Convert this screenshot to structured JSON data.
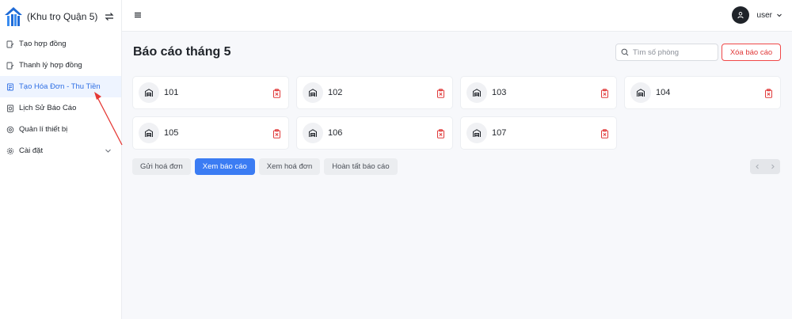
{
  "brand": {
    "name": "(Khu trọ Quận 5)"
  },
  "sidebar": {
    "items": [
      {
        "label": "Tạo hợp đồng"
      },
      {
        "label": "Thanh lý hợp đồng"
      },
      {
        "label": "Tạo Hóa Đơn - Thu Tiền"
      },
      {
        "label": "Lịch Sử Báo Cáo"
      },
      {
        "label": "Quản lí thiết bị"
      },
      {
        "label": "Cài đặt"
      }
    ]
  },
  "header": {
    "user_name": "user"
  },
  "main": {
    "title": "Báo cáo tháng 5",
    "search_placeholder": "Tìm số phòng",
    "delete_report_label": "Xóa báo cáo",
    "rooms": [
      {
        "number": "101"
      },
      {
        "number": "102"
      },
      {
        "number": "103"
      },
      {
        "number": "104"
      },
      {
        "number": "105"
      },
      {
        "number": "106"
      },
      {
        "number": "107"
      }
    ],
    "actions": {
      "send_invoice": "Gửi hoá đơn",
      "view_report": "Xem báo cáo",
      "view_invoice": "Xem hoá đơn",
      "complete_report": "Hoàn tất báo cáo"
    }
  },
  "colors": {
    "accent": "#3b7cf3",
    "active_nav_text": "#2f6fe4",
    "danger": "#e03a3a",
    "annotation_arrow": "#e53935"
  },
  "icons": {
    "brand": "house-logo-icon",
    "switch": "switch-arrows-icon",
    "room": "warehouse-icon",
    "room_delete": "delete-clipboard-icon"
  }
}
